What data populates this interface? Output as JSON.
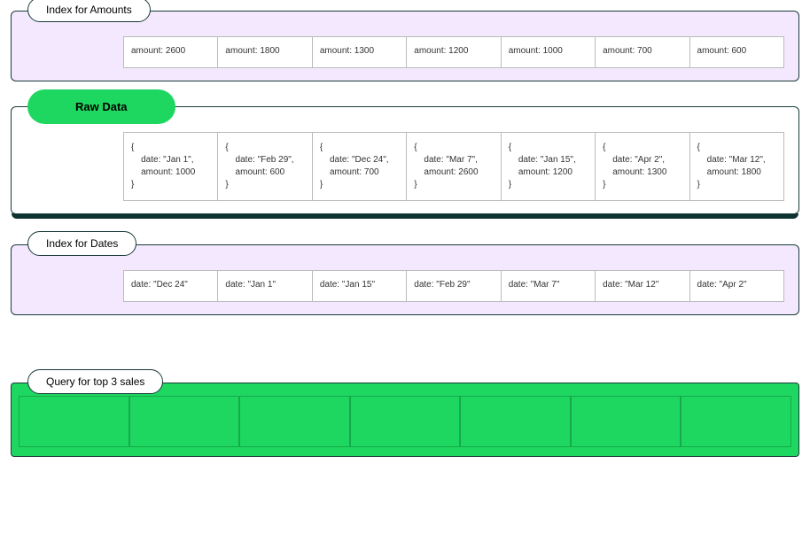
{
  "sections": {
    "amount_index": {
      "label": "Index for Amounts",
      "cells": [
        "amount: 2600",
        "amount: 1800",
        "amount: 1300",
        "amount: 1200",
        "amount: 1000",
        "amount: 700",
        "amount: 600"
      ]
    },
    "raw": {
      "label": "Raw Data",
      "cells": [
        "{\n    date: \"Jan 1\",\n    amount: 1000\n}",
        "{\n    date: \"Feb 29\",\n    amount: 600\n}",
        "{\n    date: \"Dec 24\",\n    amount: 700\n}",
        "{\n    date: \"Mar 7\",\n    amount: 2600\n}",
        "{\n    date: \"Jan 15\",\n    amount: 1200\n}",
        "{\n    date: \"Apr 2\",\n    amount: 1300\n}",
        "{\n    date: \"Mar 12\",\n    amount: 1800\n}"
      ]
    },
    "date_index": {
      "label": "Index for Dates",
      "cells": [
        "date: \"Dec 24\"",
        "date: \"Jan 1\"",
        "date: \"Jan 15\"",
        "date: \"Feb 29\"",
        "date: \"Mar 7\"",
        "date: \"Mar 12\"",
        "date: \"Apr 2\""
      ]
    },
    "query": {
      "label": "Query for top 3 sales",
      "cells": [
        "",
        "",
        "",
        "",
        "",
        "",
        ""
      ]
    }
  }
}
